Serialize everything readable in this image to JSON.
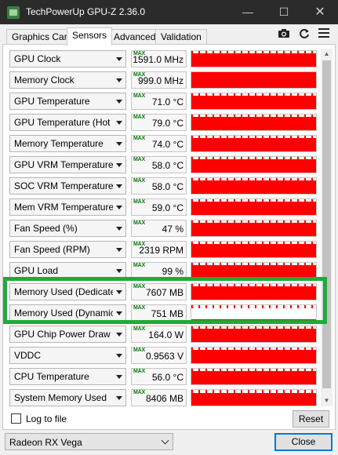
{
  "window": {
    "title": "TechPowerUp GPU-Z 2.36.0",
    "minimize_glyph": "—",
    "maximize_glyph": "☐",
    "close_glyph": "✕"
  },
  "tabs": [
    {
      "label": "Graphics Card",
      "active": false
    },
    {
      "label": "Sensors",
      "active": true
    },
    {
      "label": "Advanced",
      "active": false
    },
    {
      "label": "Validation",
      "active": false
    }
  ],
  "toolbar": {
    "camera_icon": "camera-icon",
    "refresh_icon": "refresh-icon",
    "menu_icon": "hamburger-menu-icon"
  },
  "max_tag": "MAX",
  "sensors": [
    {
      "label": "GPU Clock",
      "value": "1591.0 MHz",
      "graph_level": 0.85,
      "highlighted": false
    },
    {
      "label": "Memory Clock",
      "value": "999.0 MHz",
      "graph_level": 1.0,
      "highlighted": false
    },
    {
      "label": "GPU Temperature",
      "value": "71.0 °C",
      "graph_level": 0.85,
      "highlighted": false
    },
    {
      "label": "GPU Temperature (Hot Spot)",
      "value": "79.0 °C",
      "graph_level": 0.85,
      "highlighted": false
    },
    {
      "label": "Memory Temperature",
      "value": "74.0 °C",
      "graph_level": 0.85,
      "highlighted": false
    },
    {
      "label": "GPU VRM Temperature",
      "value": "58.0 °C",
      "graph_level": 0.85,
      "highlighted": false
    },
    {
      "label": "SOC VRM Temperature",
      "value": "58.0 °C",
      "graph_level": 0.85,
      "highlighted": false
    },
    {
      "label": "Mem VRM Temperature",
      "value": "59.0 °C",
      "graph_level": 0.85,
      "highlighted": false
    },
    {
      "label": "Fan Speed (%)",
      "value": "47 %",
      "graph_level": 0.85,
      "highlighted": false
    },
    {
      "label": "Fan Speed (RPM)",
      "value": "2319 RPM",
      "graph_level": 0.85,
      "highlighted": false
    },
    {
      "label": "GPU Load",
      "value": "99 %",
      "graph_level": 0.85,
      "highlighted": false
    },
    {
      "label": "Memory Used (Dedicated)",
      "value": "7607 MB",
      "graph_level": 0.85,
      "highlighted": true
    },
    {
      "label": "Memory Used (Dynamic)",
      "value": "751 MB",
      "graph_level": 0.1,
      "highlighted": true
    },
    {
      "label": "GPU Chip Power Draw",
      "value": "164.0 W",
      "graph_level": 0.85,
      "highlighted": false
    },
    {
      "label": "VDDC",
      "value": "0.9563 V",
      "graph_level": 0.85,
      "highlighted": false
    },
    {
      "label": "CPU Temperature",
      "value": "56.0 °C",
      "graph_level": 0.85,
      "highlighted": false
    },
    {
      "label": "System Memory Used",
      "value": "8406 MB",
      "graph_level": 0.8,
      "highlighted": false
    }
  ],
  "colors": {
    "graph": "#ff0000",
    "highlight": "#1faa3a",
    "max_tag": "#0a7a0a",
    "titlebar": "#2b2b2b"
  },
  "footer": {
    "log_label": "Log to file",
    "log_checked": false,
    "reset_label": "Reset",
    "gpu_selected": "Radeon RX Vega",
    "close_label": "Close"
  }
}
